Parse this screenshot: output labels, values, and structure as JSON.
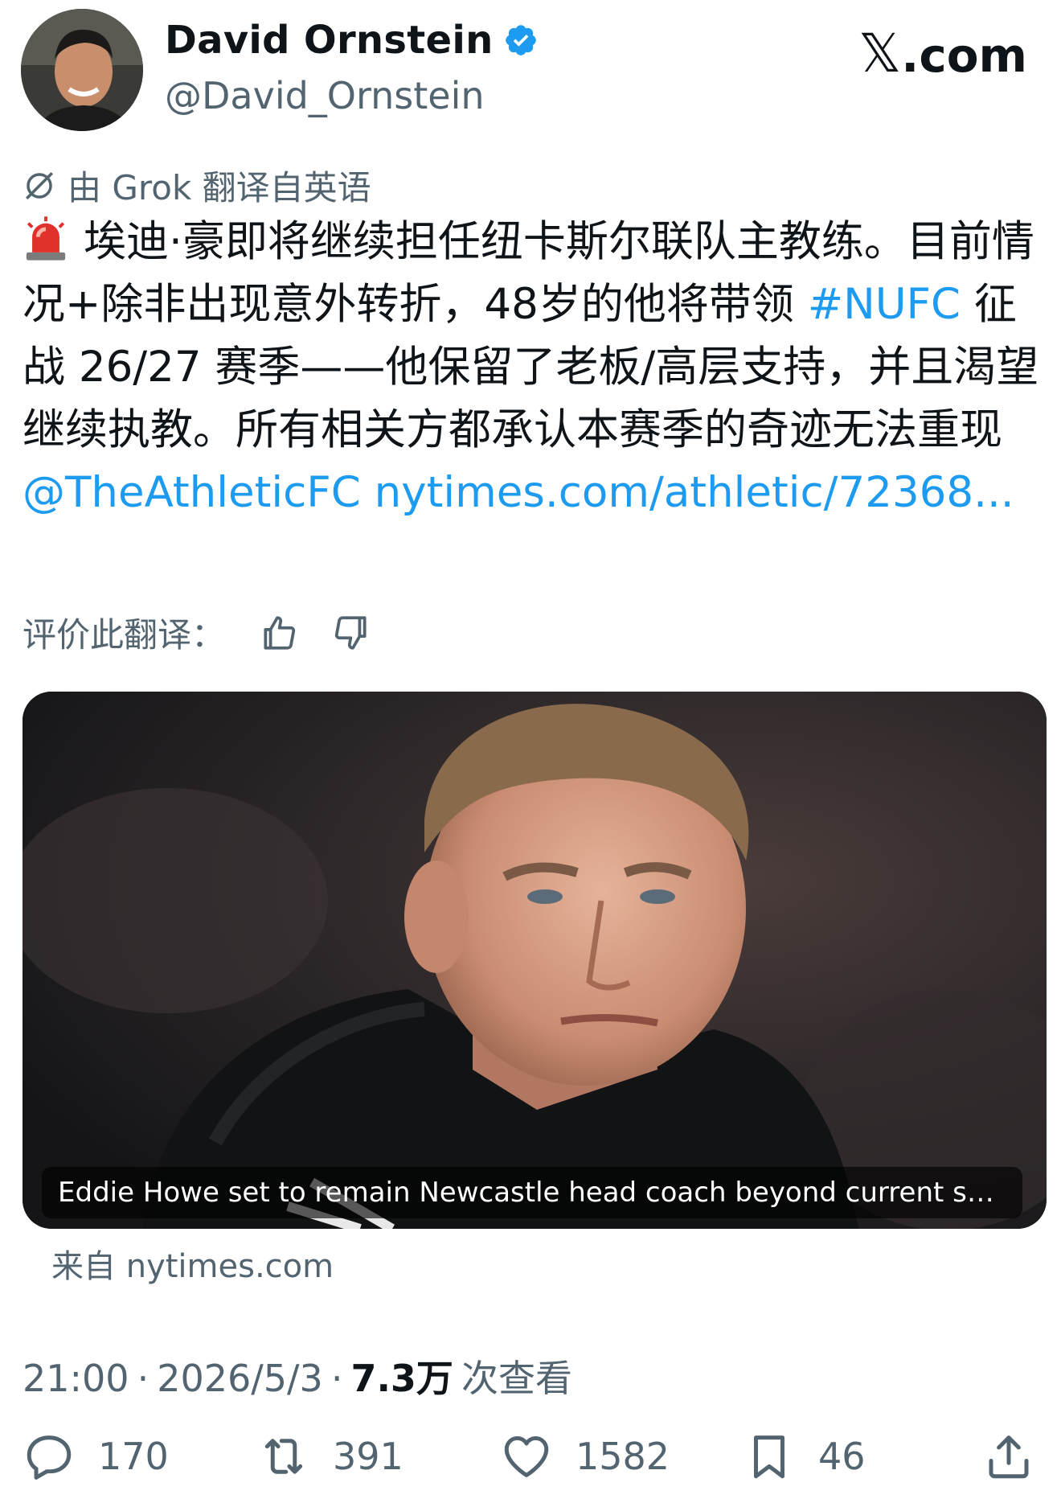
{
  "author": {
    "name": "David Ornstein",
    "handle": "@David_Ornstein",
    "verified": true
  },
  "brand": {
    "logo_suffix": ".com",
    "logo_mark": "𝕏"
  },
  "translation": {
    "note": "由 Grok 翻译自英语",
    "rate_label": "评价此翻译："
  },
  "tweet": {
    "text_1": "埃迪·豪即将继续担任纽卡斯尔联队主教练。目前情况+除非出现意外转折，48岁的他将带领 ",
    "hashtag": "#NUFC",
    "text_2": " 征战 26/27 赛季——他保留了老板/高层支持，并且渴望继续执教。所有相关方都承认本赛季的奇迹无法重现 ",
    "mention": "@TheAthleticFC",
    "link": "nytimes.com/athletic/72368..."
  },
  "card": {
    "caption": "Eddie Howe set to remain Newcastle head coach beyond current se...",
    "source": "来自 nytimes.com"
  },
  "meta": {
    "time": "21:00",
    "dot": "·",
    "date": "2026/5/3",
    "views_count": "7.3万",
    "views_label": "次查看"
  },
  "actions": {
    "replies": "170",
    "reposts": "391",
    "likes": "1582",
    "bookmarks": "46"
  },
  "colors": {
    "link": "#1d9bf0",
    "secondary": "#536471",
    "text": "#0f1419"
  }
}
